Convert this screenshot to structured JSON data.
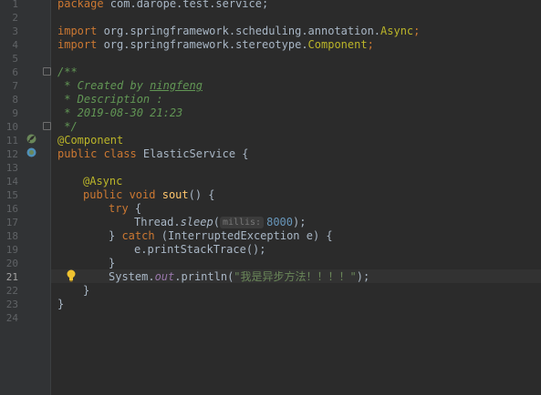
{
  "editor": {
    "line_numbers": [
      "1",
      "2",
      "3",
      "4",
      "5",
      "6",
      "7",
      "8",
      "9",
      "10",
      "11",
      "12",
      "13",
      "14",
      "15",
      "16",
      "17",
      "18",
      "19",
      "20",
      "21",
      "22",
      "23",
      "24"
    ],
    "current_line": "21",
    "lines": {
      "l1_kw": "package",
      "l1_rest": " com.darope.test.service;",
      "l3_kw": "import",
      "l3_pkg": " org.springframework.scheduling.annotation.",
      "l3_cls": "Async",
      "l3_end": ";",
      "l4_kw": "import",
      "l4_pkg": " org.springframework.stereotype.",
      "l4_cls": "Component",
      "l4_end": ";",
      "l6": "/**",
      "l7_pre": " * Created by ",
      "l7_name": "ningfeng",
      "l8": " * Description :",
      "l9": " * 2019-08-30 21:23",
      "l10": " */",
      "l11": "@Component",
      "l12_kw": "public class",
      "l12_rest": " ElasticService {",
      "l14": "@Async",
      "l15_kw": "public void",
      "l15_fn": "sout",
      "l15_rest": "() {",
      "l16_kw": "try",
      "l16_rest": " {",
      "l17_cls": "Thread.",
      "l17_fn": "sleep",
      "l17_open": "(",
      "l17_hint": "millis:",
      "l17_num": "8000",
      "l17_end": ");",
      "l18_pre": "} ",
      "l18_kw": "catch",
      "l18_rest": " (InterruptedException e) {",
      "l19": "e.printStackTrace();",
      "l20": "}",
      "l21_cls": "System.",
      "l21_fld": "out",
      "l21_mid": ".println(",
      "l21_str": "\"我是异步方法！！！！\"",
      "l21_end": ");",
      "l22": "}",
      "l23": "}"
    },
    "gutter_icons": [
      "spring-bean-icon",
      "bean-class-icon"
    ],
    "intention_icon": "lightbulb-icon"
  }
}
